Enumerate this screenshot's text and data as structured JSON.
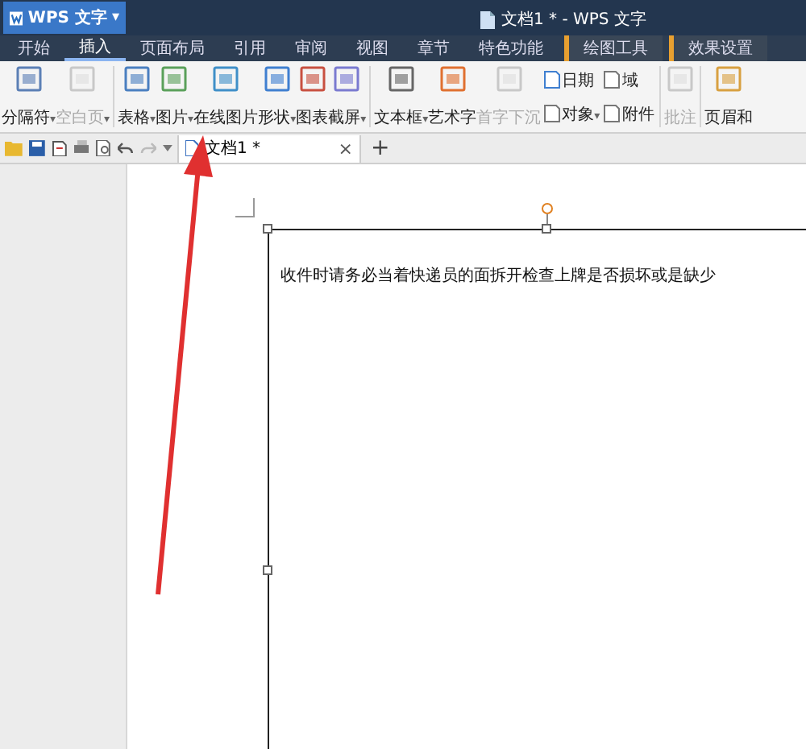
{
  "app_menu": {
    "label": "WPS 文字",
    "caret": "▾"
  },
  "window": {
    "title": "文档1 * - WPS 文字"
  },
  "tabs": [
    {
      "label": "开始",
      "selected": false,
      "contextual": false
    },
    {
      "label": "插入",
      "selected": true,
      "contextual": false
    },
    {
      "label": "页面布局",
      "selected": false,
      "contextual": false
    },
    {
      "label": "引用",
      "selected": false,
      "contextual": false
    },
    {
      "label": "审阅",
      "selected": false,
      "contextual": false
    },
    {
      "label": "视图",
      "selected": false,
      "contextual": false
    },
    {
      "label": "章节",
      "selected": false,
      "contextual": false
    },
    {
      "label": "特色功能",
      "selected": false,
      "contextual": false
    },
    {
      "label": "绘图工具",
      "selected": false,
      "contextual": true
    },
    {
      "label": "效果设置",
      "selected": false,
      "contextual": true
    }
  ],
  "ribbon": [
    {
      "items": [
        {
          "kind": "large",
          "label": "分隔符",
          "caret": "▾",
          "disabled": false
        },
        {
          "kind": "large",
          "label": "空白页",
          "caret": "▾",
          "disabled": true
        }
      ]
    },
    {
      "items": [
        {
          "kind": "large",
          "label": "表格",
          "caret": "▾",
          "disabled": false
        },
        {
          "kind": "large",
          "label": "图片",
          "caret": "▾",
          "disabled": false
        },
        {
          "kind": "large",
          "label": "在线图片",
          "disabled": false
        },
        {
          "kind": "large",
          "label": "形状",
          "caret": "▾",
          "disabled": false
        },
        {
          "kind": "large",
          "label": "图表",
          "disabled": false
        },
        {
          "kind": "large",
          "label": "截屏",
          "caret": "▾",
          "disabled": false
        }
      ]
    },
    {
      "items": [
        {
          "kind": "large",
          "label": "文本框",
          "caret": "▾",
          "disabled": false
        },
        {
          "kind": "large",
          "label": "艺术字",
          "disabled": false
        },
        {
          "kind": "large",
          "label": "首字下沉",
          "disabled": true
        },
        {
          "kind": "small",
          "label": "日期",
          "disabled": false
        },
        {
          "kind": "small",
          "label": "对象",
          "caret": "▾",
          "disabled": false
        },
        {
          "kind": "small",
          "label": "域",
          "disabled": false
        },
        {
          "kind": "small",
          "label": "附件",
          "disabled": false
        }
      ]
    },
    {
      "items": [
        {
          "kind": "large",
          "label": "批注",
          "disabled": true
        }
      ]
    },
    {
      "items": [
        {
          "kind": "large",
          "label": "页眉和",
          "disabled": false
        }
      ]
    }
  ],
  "document_tab": {
    "label": "文档1 *",
    "close": "×",
    "new_tab": "+"
  },
  "document": {
    "text": "收件时请务必当着快递员的面拆开检查上牌是否损坏或是缺少"
  }
}
